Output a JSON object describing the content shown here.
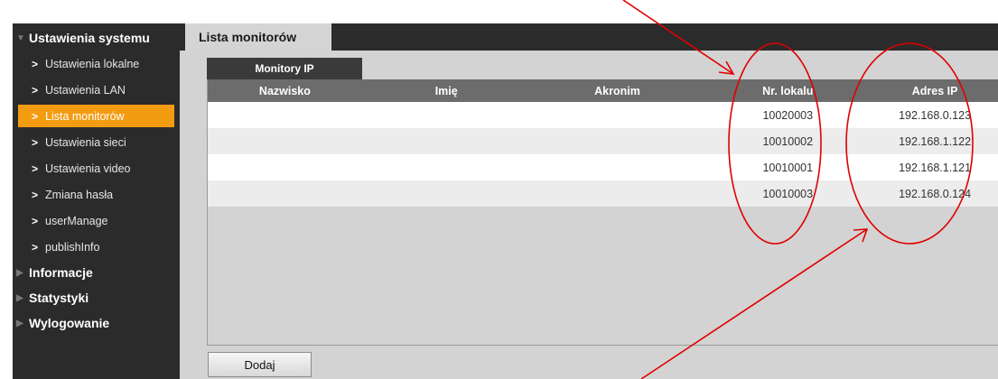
{
  "sidebar": {
    "sections": [
      {
        "label": "Ustawienia systemu"
      },
      {
        "label": "Informacje"
      },
      {
        "label": "Statystyki"
      },
      {
        "label": "Wylogowanie"
      }
    ],
    "items": [
      {
        "label": "Ustawienia lokalne"
      },
      {
        "label": "Ustawienia LAN"
      },
      {
        "label": "Lista monitorów"
      },
      {
        "label": "Ustawienia sieci"
      },
      {
        "label": "Ustawienia video"
      },
      {
        "label": "Zmiana hasła"
      },
      {
        "label": "userManage"
      },
      {
        "label": "publishInfo"
      }
    ],
    "active_item": "Lista monitorów"
  },
  "main": {
    "tab_label": "Lista monitorów",
    "subtab_label": "Monitory IP",
    "columns": [
      "Nazwisko",
      "Imię",
      "Akronim",
      "Nr. lokalu",
      "Adres IP"
    ],
    "rows": [
      {
        "nazwisko": "",
        "imie": "",
        "akronim": "",
        "nr_lokalu": "10020003",
        "adres_ip": "192.168.0.123"
      },
      {
        "nazwisko": "",
        "imie": "",
        "akronim": "",
        "nr_lokalu": "10010002",
        "adres_ip": "192.168.1.122"
      },
      {
        "nazwisko": "",
        "imie": "",
        "akronim": "",
        "nr_lokalu": "10010001",
        "adres_ip": "192.168.1.121"
      },
      {
        "nazwisko": "",
        "imie": "",
        "akronim": "",
        "nr_lokalu": "10010003",
        "adres_ip": "192.168.0.124"
      }
    ],
    "add_label": "Dodaj"
  },
  "colors": {
    "accent": "#f39c12",
    "annotation": "#e00000"
  }
}
